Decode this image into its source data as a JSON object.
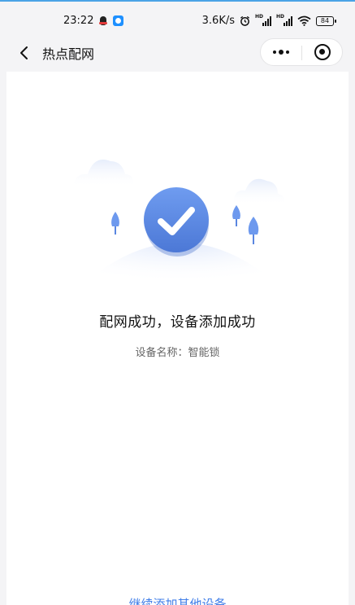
{
  "status_bar": {
    "time": "23:22",
    "net_speed": "3.6K/s",
    "sim1_label": "HD",
    "sim2_label": "HD",
    "battery": "84"
  },
  "nav": {
    "title": "热点配网"
  },
  "result": {
    "title": "配网成功，设备添加成功",
    "device_name": "设备名称：智能锁"
  },
  "actions": {
    "continue_label": "继续添加其他设备"
  },
  "colors": {
    "accent": "#5b88e3",
    "link": "#3f7de8"
  }
}
